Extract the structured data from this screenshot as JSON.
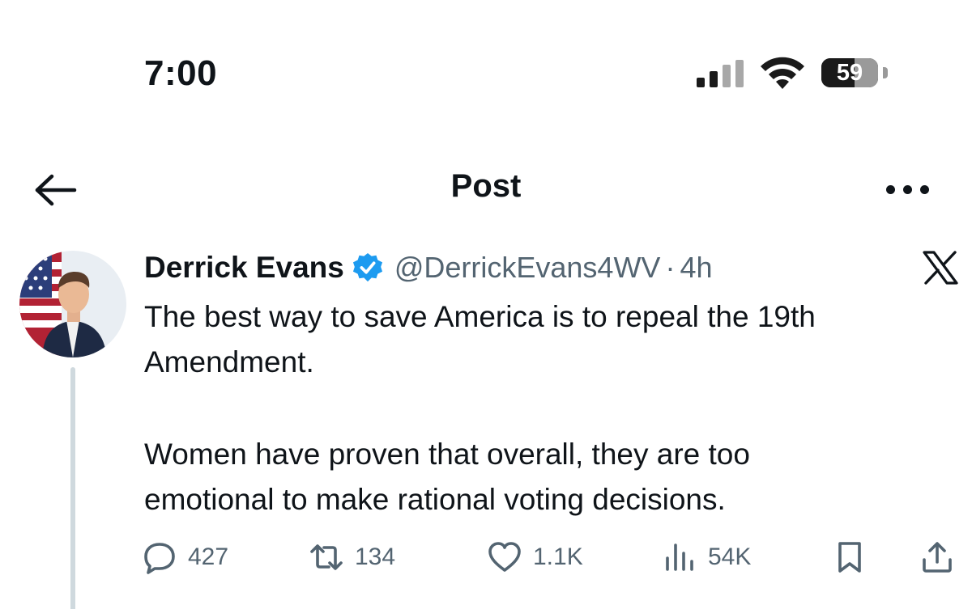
{
  "status_bar": {
    "time": "7:00",
    "battery_level": "59",
    "icons": [
      "cellular-signal-icon",
      "wifi-icon",
      "battery-icon"
    ]
  },
  "header": {
    "title": "Post",
    "icons": [
      "back-arrow-icon",
      "more-options-icon"
    ]
  },
  "post": {
    "author": {
      "display_name": "Derrick Evans",
      "verified": true,
      "handle": "@DerrickEvans4WV",
      "separator": "·",
      "posted_ago": "4h"
    },
    "body_lines": [
      "The best way to save America is to repeal the 19th",
      "Amendment.",
      "Women have proven that overall, they are too",
      "emotional to make rational voting decisions."
    ],
    "actions": {
      "replies": "427",
      "reposts": "134",
      "likes": "1.1K",
      "views": "54K"
    },
    "action_icons": [
      "reply-icon",
      "repost-icon",
      "like-icon",
      "views-icon",
      "bookmark-icon",
      "share-icon"
    ],
    "platform_logo": "x-logo-icon"
  },
  "colors": {
    "text_primary": "#0f1419",
    "text_secondary": "#536471",
    "verified_blue": "#1d9bf0",
    "thread_line": "#cfd9de"
  }
}
